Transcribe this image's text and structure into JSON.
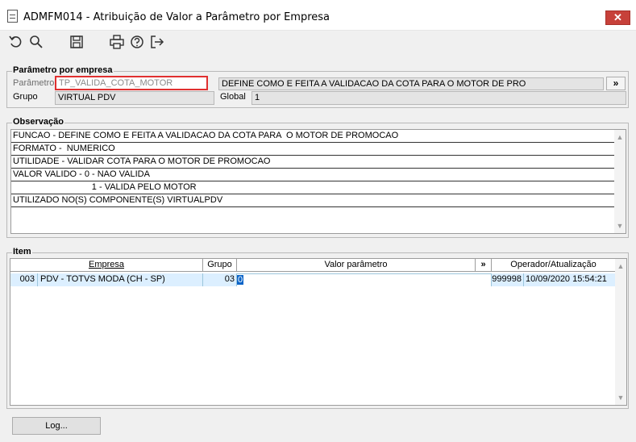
{
  "window": {
    "title": "ADMFM014 - Atribuição de Valor a Parâmetro por Empresa",
    "close_glyph": "✕"
  },
  "toolbar": {
    "icons": [
      "undo-icon",
      "search-icon",
      "save-icon",
      "print-icon",
      "help-icon",
      "exit-icon"
    ]
  },
  "parametro": {
    "group_title": "Parâmetro por empresa",
    "parametro_label": "Parâmetro",
    "parametro_value": "TP_VALIDA_COTA_MOTOR",
    "description": "DEFINE COMO E FEITA A VALIDACAO DA COTA PARA  O MOTOR DE PRO",
    "expand_label": "»",
    "grupo_label": "Grupo",
    "grupo_value": "VIRTUAL PDV",
    "global_label": "Global",
    "global_value": "1"
  },
  "observacao": {
    "group_title": "Observação",
    "lines": [
      "FUNCAO - DEFINE COMO E FEITA A VALIDACAO DA COTA PARA  O MOTOR DE PROMOCAO",
      "FORMATO -  NUMERICO",
      "UTILIDADE - VALIDAR COTA PARA O MOTOR DE PROMOCAO",
      "VALOR VALIDO - 0 - NAO VALIDA",
      "                                1 - VALIDA PELO MOTOR",
      "UTILIZADO NO(S) COMPONENTE(S) VIRTUALPDV"
    ]
  },
  "item": {
    "group_title": "Item",
    "columns": {
      "empresa": "Empresa",
      "grupo": "Grupo",
      "valor": "Valor parâmetro",
      "expand": "»",
      "operador": "Operador/Atualização"
    },
    "row": {
      "code": "003",
      "empresa": "PDV - TOTVS MODA (CH - SP)",
      "grupo": "03",
      "valor": "0",
      "operador": "999998",
      "atualizacao": "10/09/2020 15:54:21"
    }
  },
  "log_button": "Log...",
  "colors": {
    "selected_row": "#dcefff",
    "highlight_box": "#e03030",
    "close_button": "#c7413a",
    "value_cell": "#0a64c8"
  }
}
